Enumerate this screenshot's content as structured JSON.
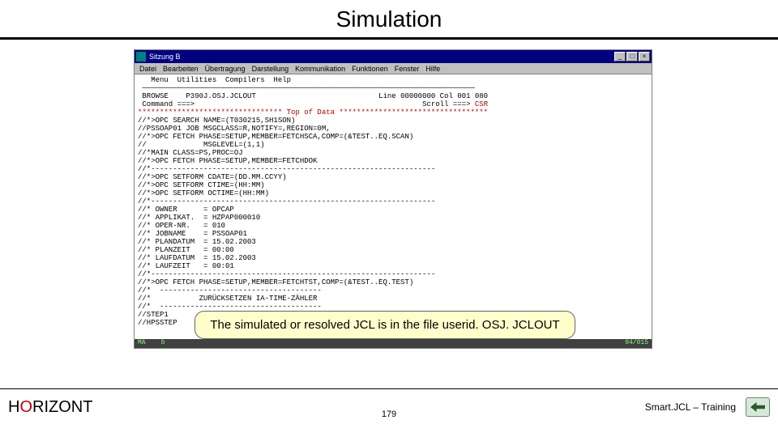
{
  "title": "Simulation",
  "window": {
    "title": "Sitzung B",
    "menubar": [
      "Datei",
      "Bearbeiten",
      "Übertragung",
      "Darstellung",
      "Kommunikation",
      "Funktionen",
      "Fenster",
      "Hilfe"
    ],
    "controls": {
      "min": "_",
      "max": "□",
      "close": "×"
    }
  },
  "terminal": {
    "menu_line": "   Menu  Utilities  Compilers  Help",
    "browse_line_left": " BROWSE    P390J.OSJ.JCLOUT",
    "browse_line_right": "Line 00000000 Col 001 080",
    "command_line_left": " Command ===>",
    "command_line_right": "Scroll ===> ",
    "scroll_value": "CSR",
    "top_of_data": "********************************* Top of Data **********************************",
    "lines": [
      "//*>OPC SEARCH NAME=(T030215,SH1SON)",
      "//PSSOAP01 JOB MSGCLASS=R,NOTIFY=,REGION=0M,",
      "//*>OPC FETCH PHASE=SETUP,MEMBER=FETCHSCA,COMP=(&TEST..EQ.SCAN)",
      "//             MSGLEVEL=(1,1)",
      "//*MAIN CLASS=PS,PROC=OJ",
      "//*>OPC FETCH PHASE=SETUP,MEMBER=FETCHDOK",
      "//*-----------------------------------------------------------------",
      "//*>OPC SETFORM CDATE=(DD.MM.CCYY)",
      "//*>OPC SETFORM CTIME=(HH:MM)",
      "//*>OPC SETFORM OCTIME=(HH:MM)",
      "//*-----------------------------------------------------------------",
      "//* OWNER      = OPCAP",
      "//* APPLIKAT.  = HZPAP000010",
      "//* OPER-NR.   = 010",
      "//* JOBNAME    = PSSOAP01",
      "//* PLANDATUM  = 15.02.2003",
      "//* PLANZEIT   = 00:00",
      "//* LAUFDATUM  = 15.02.2003",
      "//* LAUFZEIT   = 00:01",
      "//*-----------------------------------------------------------------",
      "//*>OPC FETCH PHASE=SETUP,MEMBER=FETCHTST,COMP=(&TEST..EQ.TEST)",
      "//*  -------------------------------------",
      "//*           ZURÜCKSETZEN IA-TIME-ZÄHLER",
      "//*  -------------------------------------",
      "//STEP1                                                               00070000",
      "//HPSSTEP"
    ],
    "status_left": "MA    b",
    "status_right": "04/015"
  },
  "callout": "The simulated or resolved JCL is in the file userid. OSJ. JCLOUT",
  "footer": {
    "logo_parts": [
      "H",
      "O",
      "RIZONT"
    ],
    "page": "179",
    "course": "Smart.JCL – Training"
  }
}
